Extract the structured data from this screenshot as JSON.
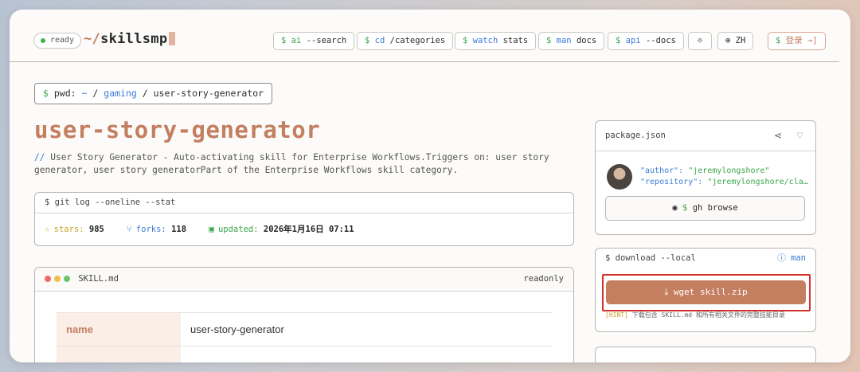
{
  "header": {
    "status": "ready",
    "logo_prefix": "~/",
    "logo_name": "skillsmp",
    "nav": [
      {
        "dollar": "$",
        "cmd": "ai",
        "arg": "--search"
      },
      {
        "dollar": "$",
        "cmd": "cd",
        "arg": "/categories"
      },
      {
        "dollar": "$",
        "cmd": "watch",
        "arg": "stats"
      },
      {
        "dollar": "$",
        "cmd": "man",
        "arg": "docs"
      },
      {
        "dollar": "$",
        "cmd": "api",
        "arg": "--docs"
      }
    ],
    "theme_icon": "☼",
    "lang_icon": "⊕",
    "lang_label": "ZH",
    "login_dollar": "$",
    "login_label": "登录",
    "login_icon": "→]"
  },
  "breadcrumb": {
    "dollar": "$",
    "prefix": "pwd:",
    "home": "~",
    "sep1": "/",
    "category": "gaming",
    "sep2": "/",
    "current": "user-story-generator"
  },
  "skill": {
    "title": "user-story-generator",
    "comment": "//",
    "description": "User Story Generator - Auto-activating skill for Enterprise Workflows.Triggers on: user story generator, user story generatorPart of the Enterprise Workflows skill category."
  },
  "git_log": {
    "header": "$ git log --oneline --stat",
    "stars_label": "stars:",
    "stars": "985",
    "forks_label": "forks:",
    "forks": "118",
    "updated_label": "updated:",
    "updated": "2026年1月16日 07:11"
  },
  "skill_md": {
    "filename": "SKILL.md",
    "mode": "readonly",
    "colors": [
      "#ee6b6b",
      "#f0c04a",
      "#6bc56b"
    ],
    "rows": [
      {
        "key": "name",
        "value": "user-story-generator"
      },
      {
        "key": "",
        "value": ""
      }
    ]
  },
  "package": {
    "filename": "package.json",
    "author_key": "\"author\":",
    "author_value": "\"jeremylongshore\"",
    "repo_key": "\"repository\":",
    "repo_value": "\"jeremylongshore/cla…",
    "gh_dollar": "$",
    "gh_label": "gh browse"
  },
  "download": {
    "header": "$ download --local",
    "man_label": "man",
    "button": "wget skill.zip",
    "hint_tag": "[HINT]",
    "hint_text": "下载包含 SKILL.md 和所有相关文件的完整技能目录"
  }
}
